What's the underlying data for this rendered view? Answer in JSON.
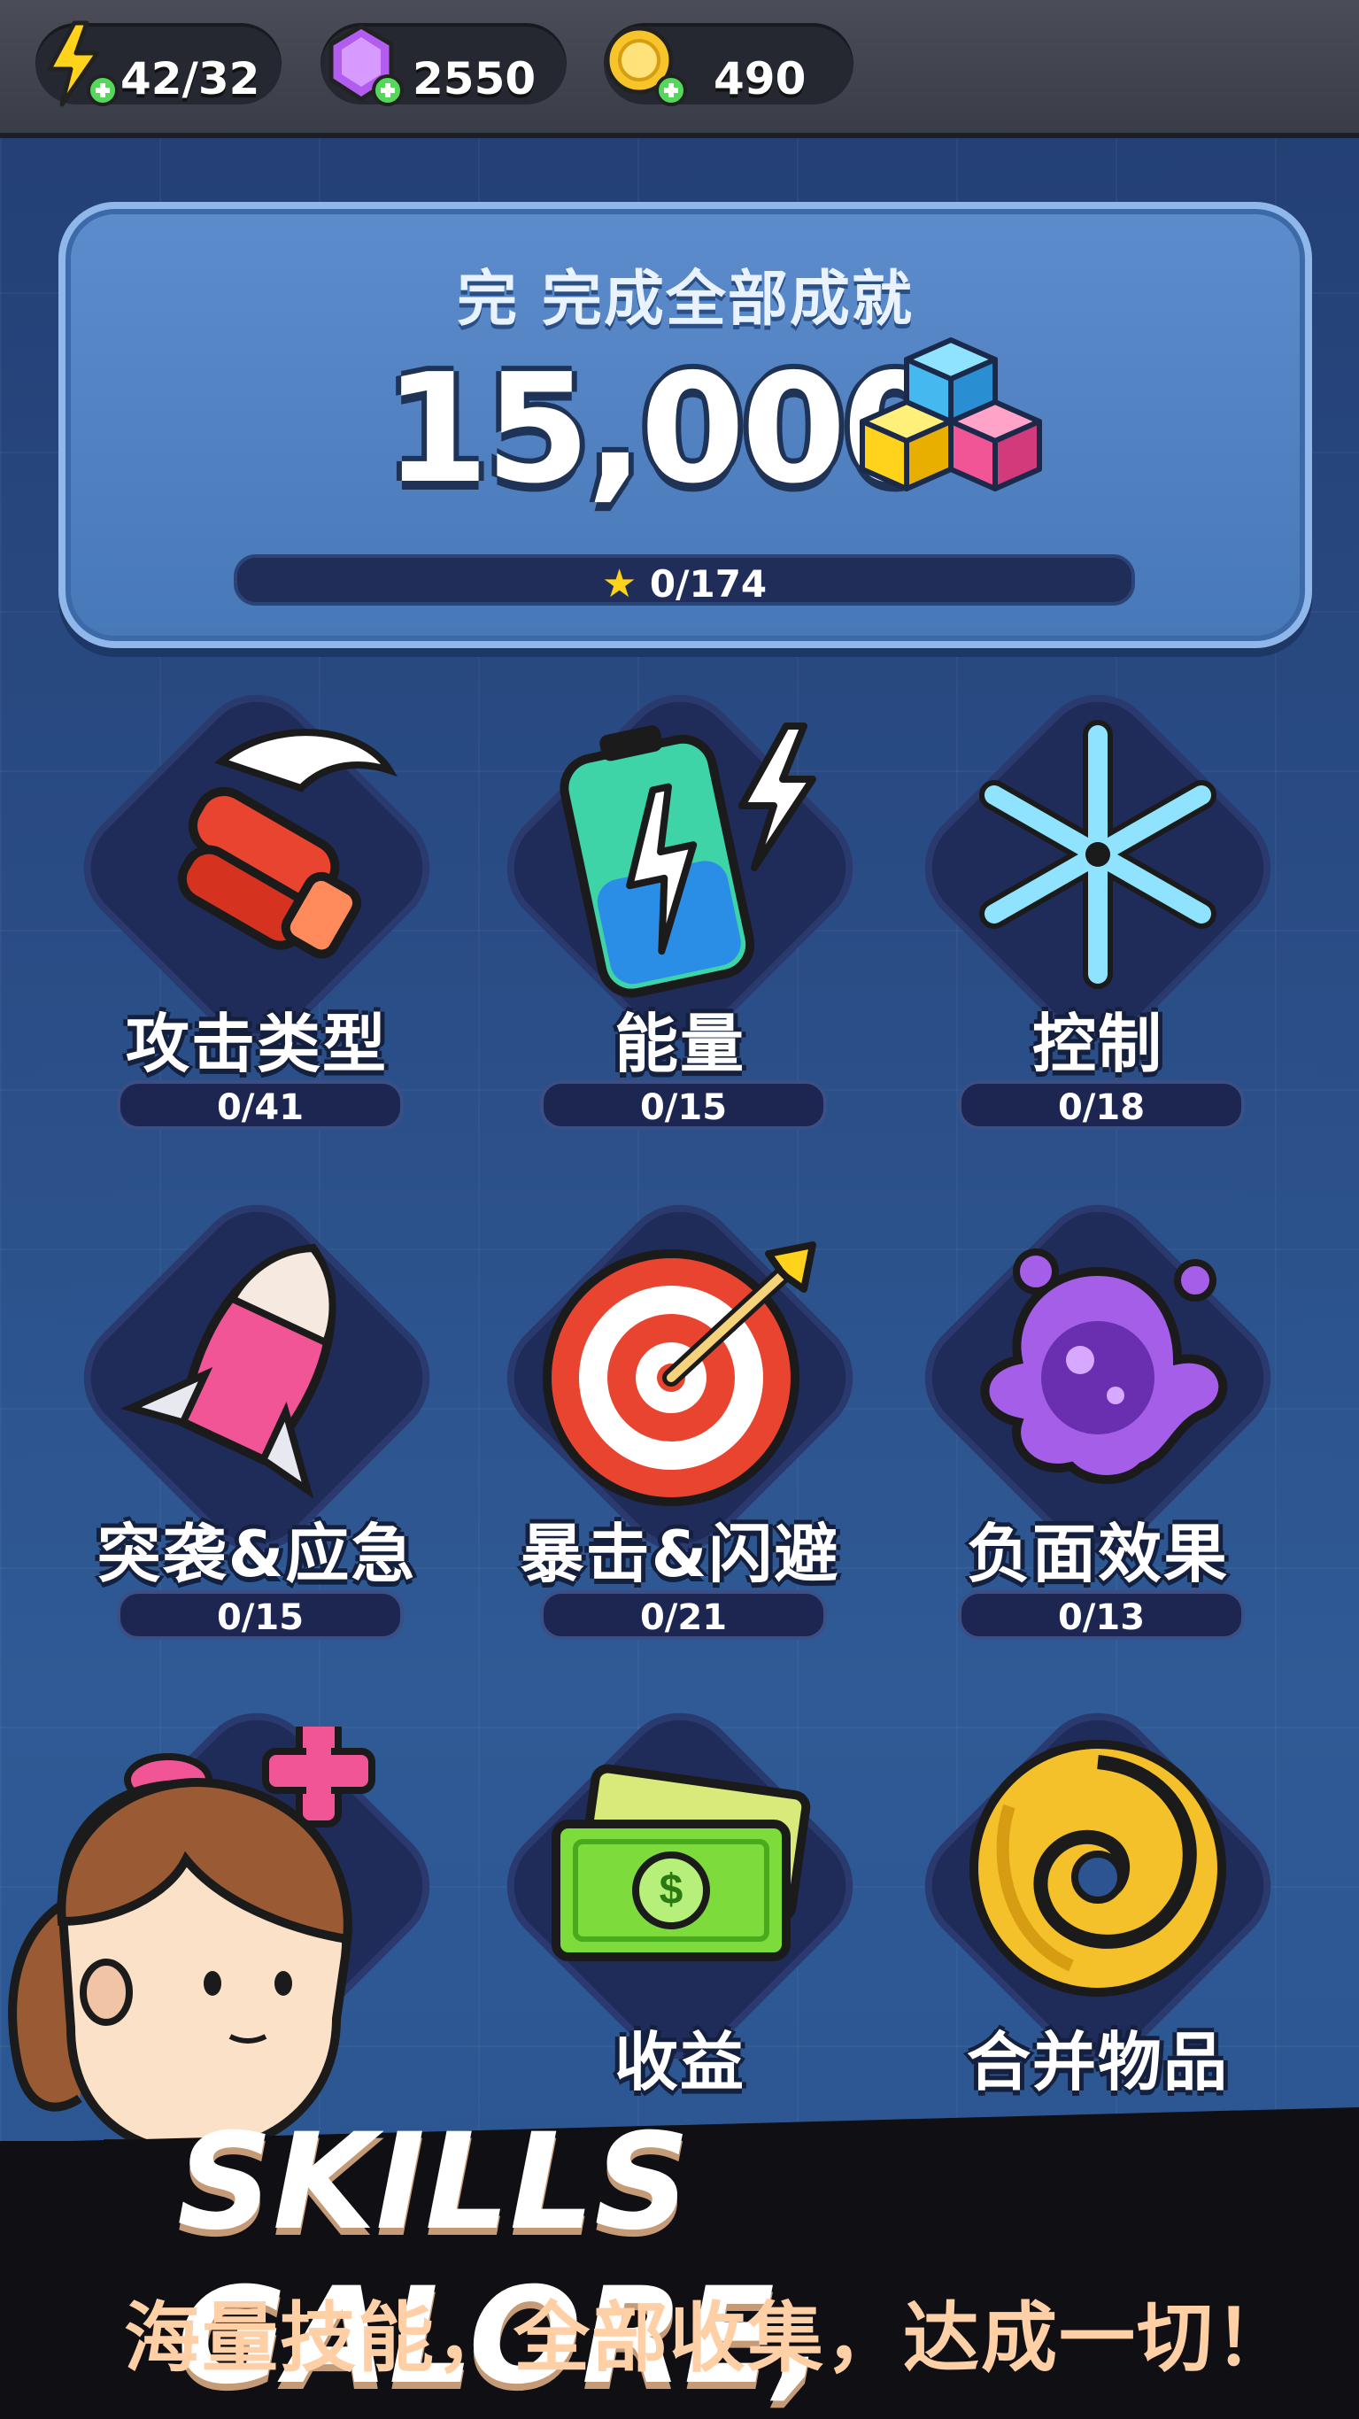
{
  "topbar": {
    "energy": {
      "icon": "lightning-plus-icon",
      "value": "42/32"
    },
    "gems": {
      "icon": "purple-gem-plus-icon",
      "value": "2550"
    },
    "coins": {
      "icon": "gold-coin-plus-icon",
      "value": "490"
    }
  },
  "header": {
    "title": "完 完成全部成就",
    "reward_amount": "15,000",
    "reward_icon": "cubes-icon",
    "progress_text": "0/174",
    "progress_fraction": 0,
    "progress_icon": "star-icon"
  },
  "categories": [
    {
      "label": "攻击类型",
      "progress": "0/41",
      "icon": "fist-punch-icon",
      "fraction": 0
    },
    {
      "label": "能量",
      "progress": "0/15",
      "icon": "battery-lightning-icon",
      "fraction": 0
    },
    {
      "label": "控制",
      "progress": "0/18",
      "icon": "snowflake-icon",
      "fraction": 0
    },
    {
      "label": "突袭&应急",
      "progress": "0/15",
      "icon": "rocket-icon",
      "fraction": 0
    },
    {
      "label": "暴击&闪避",
      "progress": "0/21",
      "icon": "target-dart-icon",
      "fraction": 0
    },
    {
      "label": "负面效果",
      "progress": "0/13",
      "icon": "poison-splat-icon",
      "fraction": 0
    },
    {
      "label": "",
      "progress": "",
      "icon": "health-cross-icon",
      "fraction": 0
    },
    {
      "label": "收益",
      "progress": "",
      "icon": "cash-icon",
      "fraction": 0
    },
    {
      "label": "合并物品",
      "progress": "",
      "icon": "vortex-icon",
      "fraction": 0
    }
  ],
  "banner": {
    "title": "SKILLS GALORE,",
    "subtitle": "海量技能，全部收集，达成一切！"
  },
  "colors": {
    "background": "#2a4d86",
    "panel": "#4f80c0",
    "bar_dark": "#1f2d58",
    "star": "#f3c630"
  }
}
